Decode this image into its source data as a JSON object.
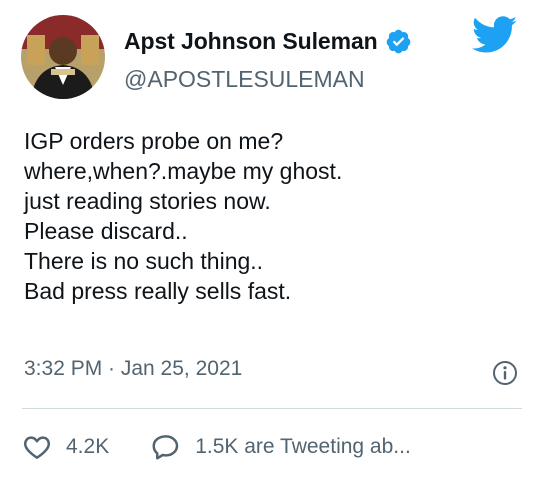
{
  "author": {
    "display_name": "Apst Johnson Suleman",
    "handle": "@APOSTLESULEMAN",
    "verified": true
  },
  "tweet": {
    "lines": [
      "IGP orders probe on me?",
      "where,when?.maybe my ghost.",
      "just reading stories now.",
      "Please discard..",
      "There is no such thing..",
      "Bad press really sells fast."
    ],
    "timestamp": "3:32 PM · Jan 25, 2021"
  },
  "actions": {
    "likes": "4.2K",
    "replies_text": "1.5K are Tweeting ab..."
  },
  "icons": {
    "brand": "twitter-bird-icon",
    "verified": "verified-badge-icon",
    "info": "info-icon",
    "like": "heart-icon",
    "reply": "speech-bubble-icon"
  },
  "colors": {
    "brand_blue": "#1da1f2",
    "text_primary": "#0f1419",
    "text_secondary": "#536471",
    "divider": "#cfd9de"
  }
}
